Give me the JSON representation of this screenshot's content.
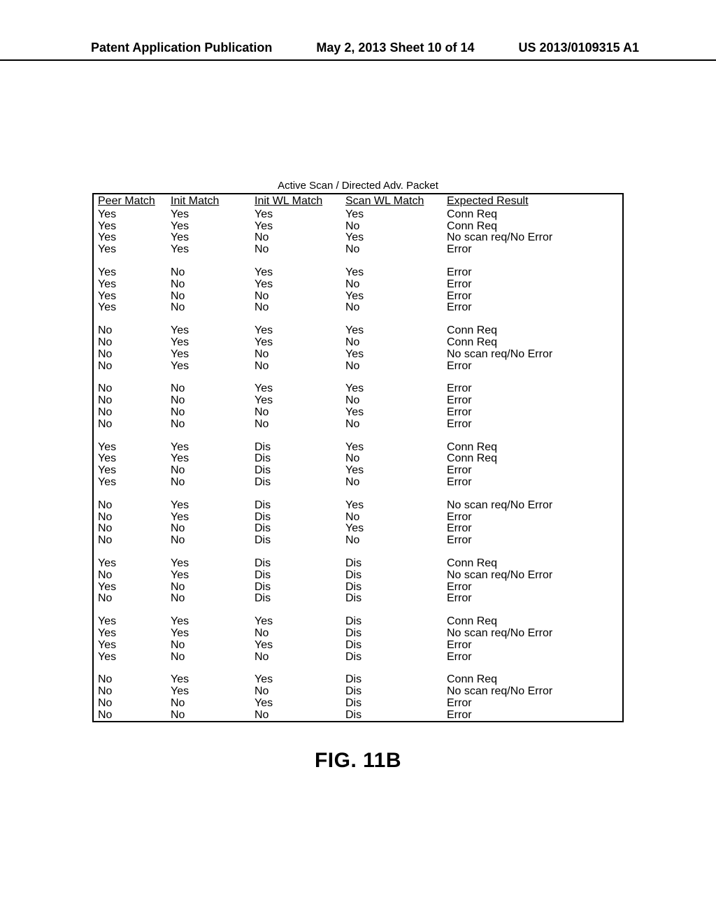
{
  "header": {
    "left": "Patent Application Publication",
    "center": "May 2, 2013  Sheet 10 of 14",
    "right": "US 2013/0109315 A1"
  },
  "table_title": "Active Scan / Directed Adv. Packet",
  "columns": [
    "Peer Match",
    "Init Match",
    "Init WL Match",
    "Scan WL Match",
    "Expected Result"
  ],
  "groups": [
    [
      [
        "Yes",
        "Yes",
        "Yes",
        "Yes",
        "Conn Req"
      ],
      [
        "Yes",
        "Yes",
        "Yes",
        "No",
        "Conn Req"
      ],
      [
        "Yes",
        "Yes",
        "No",
        "Yes",
        "No scan req/No Error"
      ],
      [
        "Yes",
        "Yes",
        "No",
        "No",
        "Error"
      ]
    ],
    [
      [
        "Yes",
        "No",
        "Yes",
        "Yes",
        "Error"
      ],
      [
        "Yes",
        "No",
        "Yes",
        "No",
        "Error"
      ],
      [
        "Yes",
        "No",
        "No",
        "Yes",
        "Error"
      ],
      [
        "Yes",
        "No",
        "No",
        "No",
        "Error"
      ]
    ],
    [
      [
        "No",
        "Yes",
        "Yes",
        "Yes",
        "Conn Req"
      ],
      [
        "No",
        "Yes",
        "Yes",
        "No",
        "Conn Req"
      ],
      [
        "No",
        "Yes",
        "No",
        "Yes",
        "No scan req/No Error"
      ],
      [
        "No",
        "Yes",
        "No",
        "No",
        "Error"
      ]
    ],
    [
      [
        "No",
        "No",
        "Yes",
        "Yes",
        "Error"
      ],
      [
        "No",
        "No",
        "Yes",
        "No",
        "Error"
      ],
      [
        "No",
        "No",
        "No",
        "Yes",
        "Error"
      ],
      [
        "No",
        "No",
        "No",
        "No",
        "Error"
      ]
    ],
    [
      [
        "Yes",
        "Yes",
        "Dis",
        "Yes",
        "Conn Req"
      ],
      [
        "Yes",
        "Yes",
        "Dis",
        "No",
        "Conn Req"
      ],
      [
        "Yes",
        "No",
        "Dis",
        "Yes",
        "Error"
      ],
      [
        "Yes",
        "No",
        "Dis",
        "No",
        "Error"
      ]
    ],
    [
      [
        "No",
        "Yes",
        "Dis",
        "Yes",
        "No scan req/No Error"
      ],
      [
        "No",
        "Yes",
        "Dis",
        "No",
        "Error"
      ],
      [
        "No",
        "No",
        "Dis",
        "Yes",
        "Error"
      ],
      [
        "No",
        "No",
        "Dis",
        "No",
        "Error"
      ]
    ],
    [
      [
        "Yes",
        "Yes",
        "Dis",
        "Dis",
        "Conn Req"
      ],
      [
        "No",
        "Yes",
        "Dis",
        "Dis",
        "No scan req/No Error"
      ],
      [
        "Yes",
        "No",
        "Dis",
        "Dis",
        "Error"
      ],
      [
        "No",
        "No",
        "Dis",
        "Dis",
        "Error"
      ]
    ],
    [
      [
        "Yes",
        "Yes",
        "Yes",
        "Dis",
        "Conn Req"
      ],
      [
        "Yes",
        "Yes",
        "No",
        "Dis",
        "No scan req/No Error"
      ],
      [
        "Yes",
        "No",
        "Yes",
        "Dis",
        "Error"
      ],
      [
        "Yes",
        "No",
        "No",
        "Dis",
        "Error"
      ]
    ],
    [
      [
        "No",
        "Yes",
        "Yes",
        "Dis",
        "Conn Req"
      ],
      [
        "No",
        "Yes",
        "No",
        "Dis",
        "No scan req/No Error"
      ],
      [
        "No",
        "No",
        "Yes",
        "Dis",
        "Error"
      ],
      [
        "No",
        "No",
        "No",
        "Dis",
        "Error"
      ]
    ]
  ],
  "figure_label": "FIG. 11B"
}
